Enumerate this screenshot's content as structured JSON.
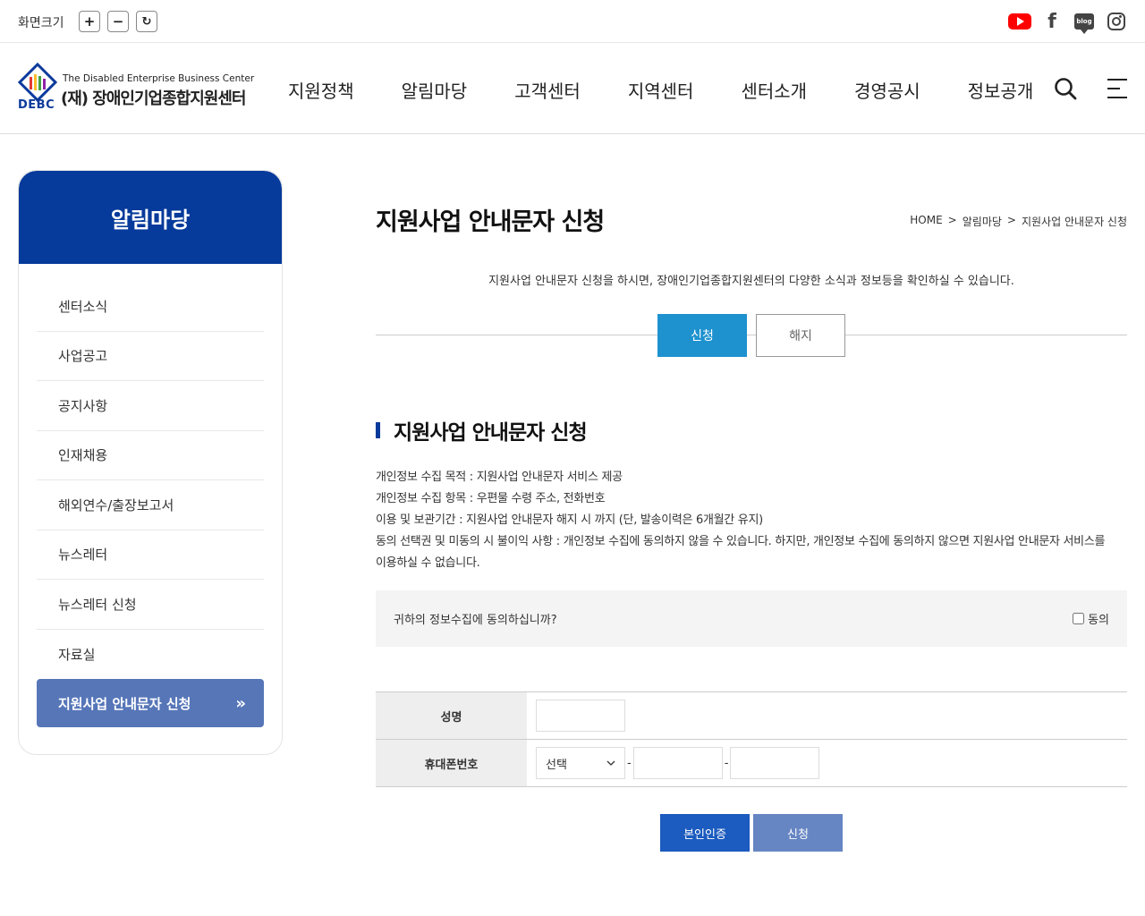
{
  "topbar": {
    "size_label": "화면크기",
    "zoom_in": "+",
    "zoom_out": "−",
    "zoom_reset": "↻",
    "social": {
      "blog_text": "blog"
    }
  },
  "header": {
    "logo_en": "The Disabled Enterprise Business Center",
    "logo_ko": "(재) 장애인기업종합지원센터",
    "logo_abbr": "DEBC",
    "menu": [
      "지원정책",
      "알림마당",
      "고객센터",
      "지역센터",
      "센터소개",
      "경영공시",
      "정보공개"
    ]
  },
  "sidebar": {
    "title": "알림마당",
    "items": [
      "센터소식",
      "사업공고",
      "공지사항",
      "인재채용",
      "해외연수/출장보고서",
      "뉴스레터",
      "뉴스레터 신청",
      "자료실"
    ],
    "active": "지원사업 안내문자 신청",
    "active_chevron": "»"
  },
  "main": {
    "title": "지원사업 안내문자 신청",
    "breadcrumb": [
      "HOME",
      ">",
      "알림마당",
      ">",
      "지원사업 안내문자 신청"
    ],
    "intro": "지원사업 안내문자 신청을 하시면, 장애인기업종합지원센터의 다양한 소식과 정보등을 확인하실 수 있습니다.",
    "tabs": {
      "apply": "신청",
      "cancel": "해지"
    },
    "section_title": "지원사업 안내문자 신청",
    "info": [
      "개인정보 수집 목적 : 지원사업 안내문자 서비스 제공",
      "개인정보 수집 항목 : 우편물 수령 주소, 전화번호",
      "이용 및 보관기간 : 지원사업 안내문자 해지 시 까지 (단, 발송이력은 6개월간 유지)",
      "동의 선택권 및 미동의 시 불이익 사항 : 개인정보 수집에 동의하지 않을 수 있습니다. 하지만, 개인정보 수집에 동의하지 않으면 지원사업 안내문자 서비스를",
      "이용하실 수 없습니다."
    ],
    "consent_question": "귀하의 정보수집에 동의하십니까?",
    "consent_label": "동의",
    "form": {
      "name_label": "성명",
      "phone_label": "휴대폰번호",
      "phone_select": "선택",
      "dash": "-"
    },
    "buttons": {
      "verify": "본인인증",
      "submit": "신청"
    }
  },
  "colors": {
    "primary": "#063a9b",
    "tab_active": "#1e92cf",
    "sidebar_active": "#5676b8",
    "verify_btn": "#1c5bbf",
    "submit_btn": "#6685c3"
  }
}
